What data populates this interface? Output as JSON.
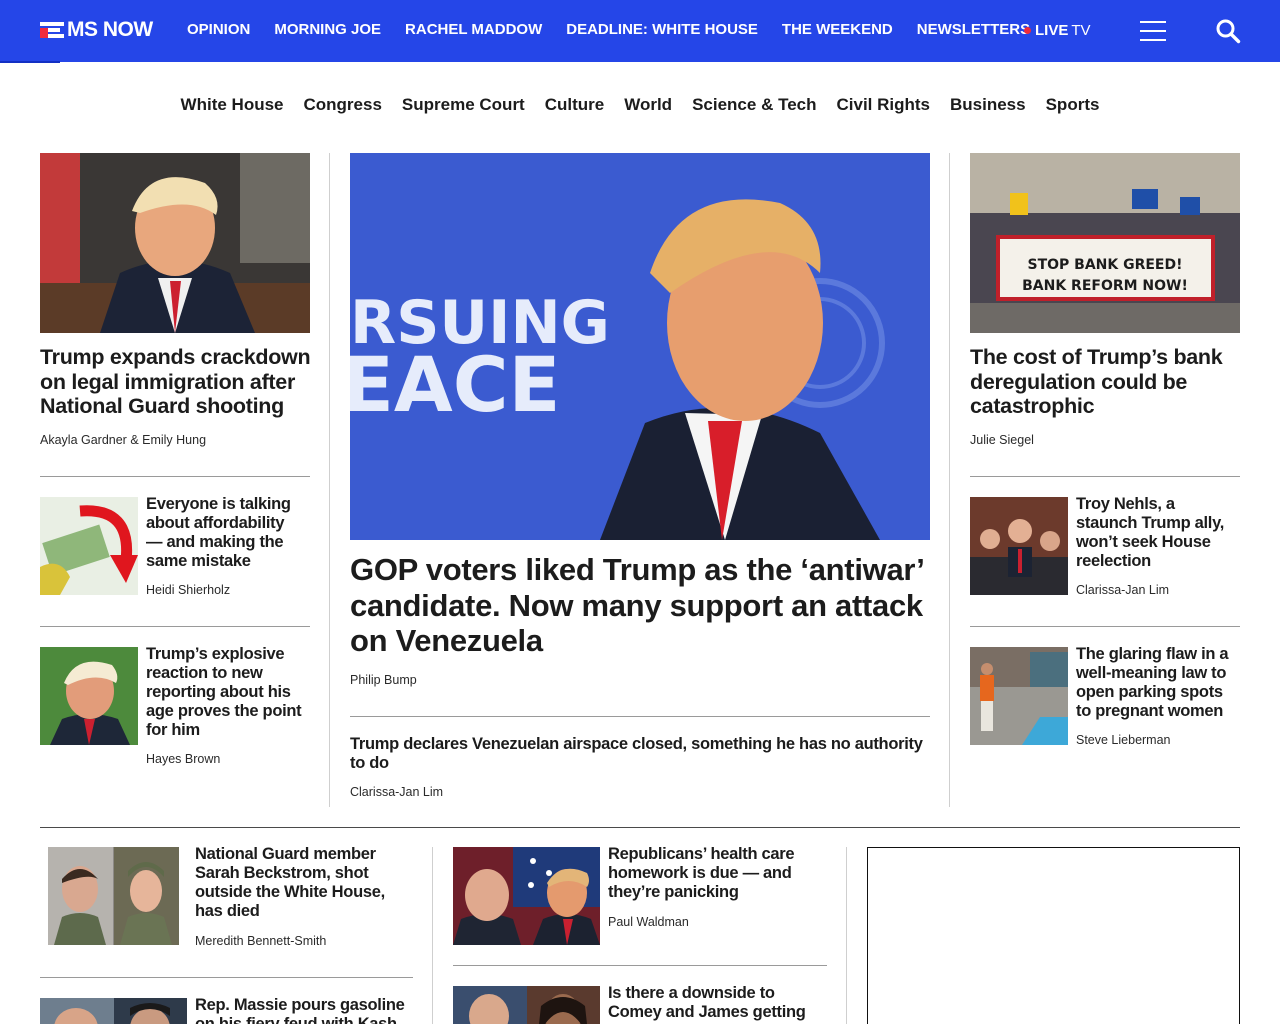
{
  "brand": {
    "name": "MS NOW",
    "accent": "#2546e8",
    "live_dot": "#ef2b3c"
  },
  "topnav": [
    "OPINION",
    "MORNING JOE",
    "RACHEL MADDOW",
    "DEADLINE: WHITE HOUSE",
    "THE WEEKEND",
    "NEWSLETTERS"
  ],
  "live": {
    "label": "LIVE",
    "suffix": "TV"
  },
  "icons": {
    "menu": "hamburger-icon",
    "search": "search-icon"
  },
  "subnav": [
    "White House",
    "Congress",
    "Supreme Court",
    "Culture",
    "World",
    "Science & Tech",
    "Civil Rights",
    "Business",
    "Sports"
  ],
  "left_column": {
    "lead": {
      "headline": "Trump expands crackdown on legal immigration after National Guard shooting",
      "byline": "Akayla Gardner & Emily Hung"
    },
    "items": [
      {
        "headline": "Everyone is talking about affordability — and making the same mistake",
        "byline": "Heidi Shierholz"
      },
      {
        "headline": "Trump’s explosive reaction to new reporting about his age proves the point for him",
        "byline": "Hayes Brown"
      }
    ]
  },
  "center_column": {
    "hero_image_text": [
      "RSUING",
      "EACE"
    ],
    "hero": {
      "headline": "GOP voters liked Trump as the ‘antiwar’ candidate. Now many support an attack on Venezuela",
      "byline": "Philip Bump"
    },
    "secondary": {
      "headline": "Trump declares Venezuelan airspace closed, something he has no authority to do",
      "byline": "Clarissa-Jan Lim"
    }
  },
  "right_column": {
    "lead": {
      "headline": "The cost of Trump’s bank deregulation could be catastrophic",
      "byline": "Julie Siegel",
      "banner_lines": [
        "STOP BANK GREED!",
        "BANK REFORM NOW!"
      ]
    },
    "items": [
      {
        "headline": "Troy Nehls, a staunch Trump ally, won’t seek House reelection",
        "byline": "Clarissa-Jan Lim"
      },
      {
        "headline": "The glaring flaw in a well-meaning law to open parking spots to pregnant women",
        "byline": "Steve Lieberman"
      }
    ]
  },
  "bottom_row": {
    "col1": [
      {
        "headline": "National Guard member Sarah Beckstrom, shot outside the White House, has died",
        "byline": "Meredith Bennett-Smith"
      },
      {
        "headline": "Rep. Massie pours gasoline on his fiery feud with Kash",
        "byline": ""
      }
    ],
    "col2": [
      {
        "headline": "Republicans’ health care homework is due — and they’re panicking",
        "byline": "Paul Waldman"
      },
      {
        "headline": "Is there a downside to Comey and James getting",
        "byline": ""
      }
    ]
  }
}
